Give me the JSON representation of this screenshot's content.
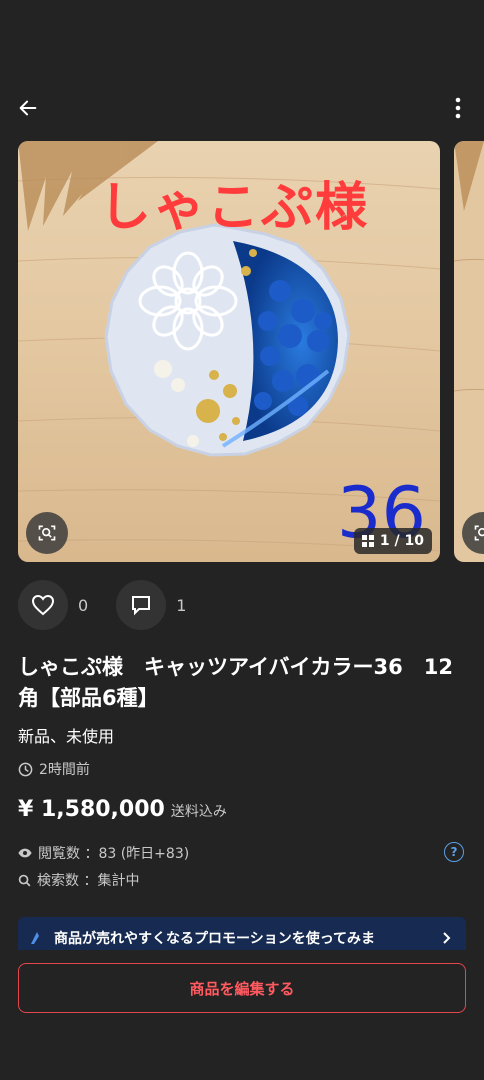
{
  "header": {
    "back_icon": "arrow-left-icon",
    "more_icon": "more-vertical-icon"
  },
  "gallery": {
    "photo_overlay_title": "しゃこぷ様",
    "photo_overlay_number": "36",
    "counter": "1 / 10",
    "lens_icon": "image-search-icon",
    "counter_icon": "grid-icon"
  },
  "social": {
    "likes": "0",
    "comments": "1"
  },
  "product": {
    "title": "しゃこぷ様　キャッツアイバイカラー36　12角【部品6種】",
    "condition": "新品、未使用",
    "posted": "2時間前",
    "price": "¥ 1,580,000",
    "shipping": "送料込み",
    "views": "閲覧数 ：83 (昨日+83)",
    "searches": "検索数 ：集計中"
  },
  "promo": {
    "text": "商品が売れやすくなるプロモーションを使ってみま"
  },
  "actions": {
    "edit_label": "商品を編集する"
  },
  "colors": {
    "background": "#232323",
    "accent_red": "#ff5a60",
    "help_blue": "#5aa0e6",
    "promo_bg": "#162a52"
  }
}
